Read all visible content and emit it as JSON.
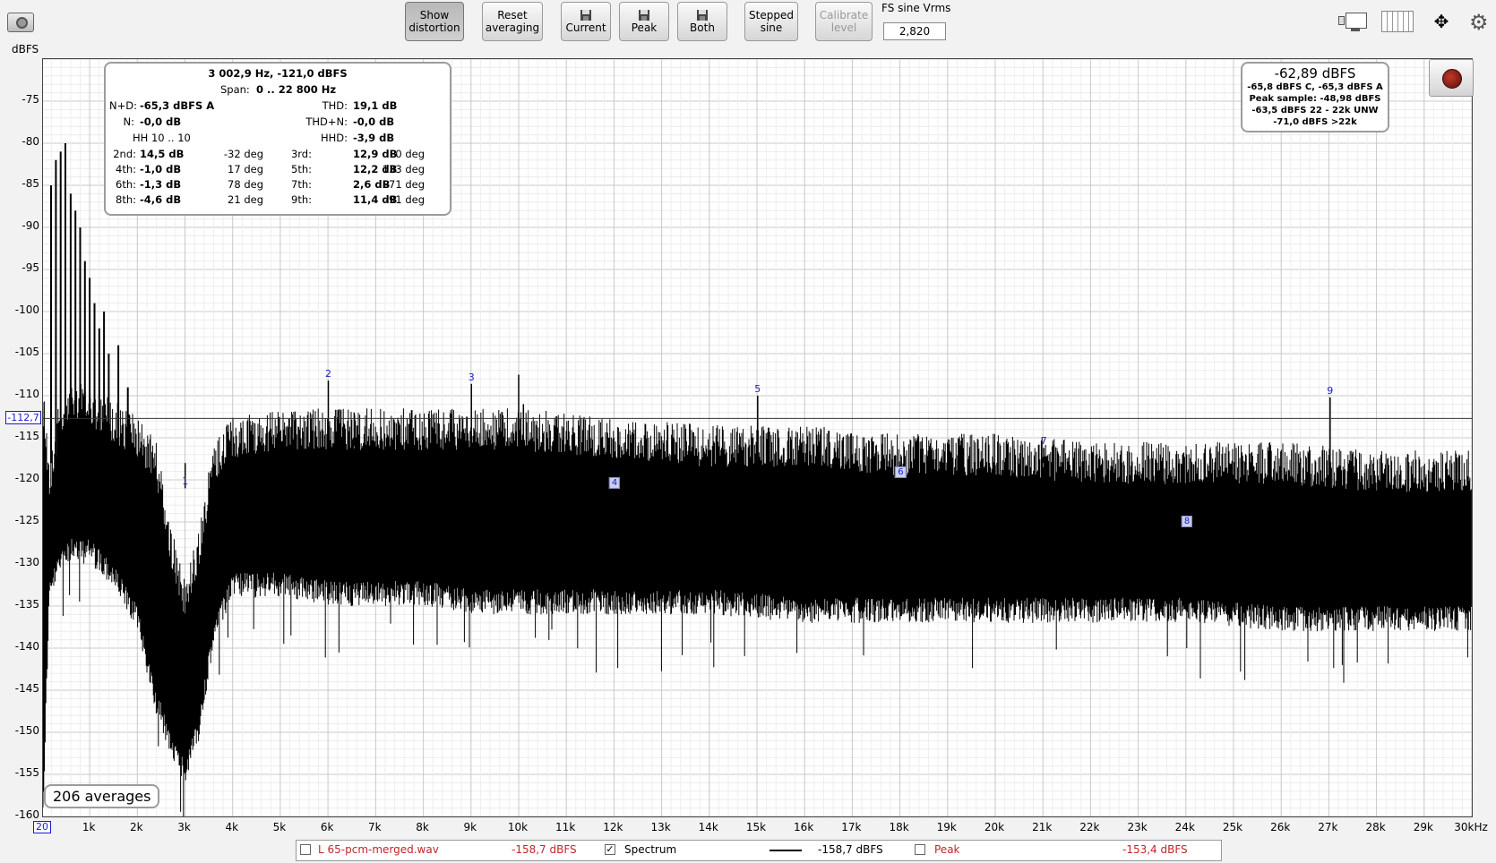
{
  "toolbar": {
    "show_distortion": [
      "Show",
      "distortion"
    ],
    "reset_averaging": [
      "Reset",
      "averaging"
    ],
    "current": "Current",
    "peak": "Peak",
    "both": "Both",
    "stepped_sine": [
      "Stepped",
      "sine"
    ],
    "calibrate_level": [
      "Calibrate",
      "level"
    ],
    "fs_label": "FS sine Vrms",
    "fs_value": "2,820"
  },
  "info": {
    "title": "3 002,9 Hz, -121,0 dBFS",
    "span_label": "Span:",
    "span_value": "0 .. 22 800 Hz",
    "nd_label": "N+D:",
    "nd_value": "-65,3 dBFS A",
    "thd_label": "THD:",
    "thd_value": "19,1 dB",
    "n_label": "N:",
    "n_value": "-0,0 dB",
    "thdn_label": "THD+N:",
    "thdn_value": "-0,0 dB",
    "hh_label": "HH 10 .. 10",
    "hhd_label": "HHD:",
    "hhd_value": "-3,9 dB",
    "harmonics": [
      {
        "label": "2nd:",
        "value": "14,5 dB",
        "phase": "-32 deg"
      },
      {
        "label": "3rd:",
        "value": "12,9 dB",
        "phase": "0 deg"
      },
      {
        "label": "4th:",
        "value": "-1,0 dB",
        "phase": "17 deg"
      },
      {
        "label": "5th:",
        "value": "12,2 dB",
        "phase": "133 deg"
      },
      {
        "label": "6th:",
        "value": "-1,3 dB",
        "phase": "78 deg"
      },
      {
        "label": "7th:",
        "value": "2,6 dB",
        "phase": "-71 deg"
      },
      {
        "label": "8th:",
        "value": "-4,6 dB",
        "phase": "21 deg"
      },
      {
        "label": "9th:",
        "value": "11,4 dB",
        "phase": "-91 deg"
      }
    ]
  },
  "level_panel": {
    "main": "-62,89 dBFS",
    "line1": "-65,8 dBFS C, -65,3 dBFS A",
    "line2": "Peak sample: -48,98 dBFS",
    "line3": "-63,5 dBFS 22 - 22k UNW",
    "line4": "-71,0 dBFS >22k"
  },
  "averages": "206 averages",
  "cursor_level": "-112,7",
  "legend": {
    "file": "L 65-pcm-merged.wav",
    "file_value": "-158,7 dBFS",
    "spectrum": "Spectrum",
    "spectrum_checked": true,
    "spectrum_value": "-158,7 dBFS",
    "peak": "Peak",
    "peak_checked": false,
    "peak_value": "-153,4 dBFS"
  },
  "colors": {
    "harmonic_marker": "#1b1bd0",
    "legend_red": "#c0262c",
    "record": "#8b1b12"
  },
  "chart_data": {
    "type": "line",
    "ylabel": "dBFS",
    "xlabel": "",
    "ylim": [
      -160,
      -70
    ],
    "xlim": [
      20,
      30000
    ],
    "grid": true,
    "y_ticks": [
      -75,
      -80,
      -85,
      -90,
      -95,
      -100,
      -105,
      -110,
      -115,
      -120,
      -125,
      -130,
      -135,
      -140,
      -145,
      -150,
      -155,
      -160
    ],
    "x_ticks": [
      {
        "hz": 20,
        "label": "20"
      },
      {
        "hz": 1000,
        "label": "1k"
      },
      {
        "hz": 2000,
        "label": "2k"
      },
      {
        "hz": 3000,
        "label": "3k"
      },
      {
        "hz": 4000,
        "label": "4k"
      },
      {
        "hz": 5000,
        "label": "5k"
      },
      {
        "hz": 6000,
        "label": "6k"
      },
      {
        "hz": 7000,
        "label": "7k"
      },
      {
        "hz": 8000,
        "label": "8k"
      },
      {
        "hz": 9000,
        "label": "9k"
      },
      {
        "hz": 10000,
        "label": "10k"
      },
      {
        "hz": 11000,
        "label": "11k"
      },
      {
        "hz": 12000,
        "label": "12k"
      },
      {
        "hz": 13000,
        "label": "13k"
      },
      {
        "hz": 14000,
        "label": "14k"
      },
      {
        "hz": 15000,
        "label": "15k"
      },
      {
        "hz": 16000,
        "label": "16k"
      },
      {
        "hz": 17000,
        "label": "17k"
      },
      {
        "hz": 18000,
        "label": "18k"
      },
      {
        "hz": 19000,
        "label": "19k"
      },
      {
        "hz": 20000,
        "label": "20k"
      },
      {
        "hz": 21000,
        "label": "21k"
      },
      {
        "hz": 22000,
        "label": "22k"
      },
      {
        "hz": 23000,
        "label": "23k"
      },
      {
        "hz": 24000,
        "label": "24k"
      },
      {
        "hz": 25000,
        "label": "25k"
      },
      {
        "hz": 26000,
        "label": "26k"
      },
      {
        "hz": 27000,
        "label": "27k"
      },
      {
        "hz": 28000,
        "label": "28k"
      },
      {
        "hz": 29000,
        "label": "29k"
      },
      {
        "hz": 30000,
        "label": "30kHz"
      }
    ],
    "cursor_dbfs": -112.7,
    "envelope": {
      "x": [
        20,
        150,
        400,
        600,
        1000,
        1500,
        2000,
        2400,
        2700,
        3000,
        3300,
        3600,
        4000,
        5000,
        6000,
        7000,
        8000,
        9000,
        10000,
        12000,
        14000,
        16000,
        18000,
        20000,
        22000,
        24000,
        26000,
        28000,
        30000
      ],
      "top": [
        -110,
        -120,
        -112,
        -110,
        -111,
        -113,
        -115,
        -118,
        -128,
        -134,
        -128,
        -118,
        -115,
        -114,
        -114,
        -114,
        -114,
        -114,
        -114,
        -115,
        -116,
        -116,
        -117,
        -117,
        -118,
        -118,
        -118,
        -119,
        -119
      ],
      "bottom": [
        -158,
        -132,
        -128,
        -127,
        -127,
        -130,
        -135,
        -145,
        -150,
        -153,
        -148,
        -137,
        -131,
        -131,
        -132,
        -132,
        -132,
        -133,
        -133,
        -133,
        -133,
        -134,
        -134,
        -134,
        -134,
        -134,
        -135,
        -135,
        -135
      ]
    },
    "low_freq_spikes": [
      {
        "hz": 190,
        "dbfs": -85
      },
      {
        "hz": 290,
        "dbfs": -82
      },
      {
        "hz": 390,
        "dbfs": -81
      },
      {
        "hz": 490,
        "dbfs": -80
      },
      {
        "hz": 600,
        "dbfs": -86
      },
      {
        "hz": 700,
        "dbfs": -88
      },
      {
        "hz": 800,
        "dbfs": -90
      },
      {
        "hz": 900,
        "dbfs": -94
      },
      {
        "hz": 1000,
        "dbfs": -96
      },
      {
        "hz": 1100,
        "dbfs": -99
      },
      {
        "hz": 1200,
        "dbfs": -102
      },
      {
        "hz": 1300,
        "dbfs": -100
      },
      {
        "hz": 1400,
        "dbfs": -105
      },
      {
        "hz": 1600,
        "dbfs": -104
      },
      {
        "hz": 1800,
        "dbfs": -109
      }
    ],
    "harmonics": [
      {
        "label": "1",
        "hz": 3002.9,
        "dbfs": -121.0,
        "boxed": false
      },
      {
        "label": "2",
        "hz": 6006,
        "dbfs": -108.2,
        "boxed": false
      },
      {
        "label": "3",
        "hz": 9009,
        "dbfs": -108.6,
        "boxed": false
      },
      {
        "label": "4",
        "hz": 12012,
        "dbfs": -120.3,
        "boxed": true
      },
      {
        "label": "5",
        "hz": 15015,
        "dbfs": -110.0,
        "boxed": false
      },
      {
        "label": "6",
        "hz": 18017,
        "dbfs": -119.0,
        "boxed": true
      },
      {
        "label": "7",
        "hz": 21020,
        "dbfs": -116.2,
        "boxed": false
      },
      {
        "label": "8",
        "hz": 24023,
        "dbfs": -124.9,
        "boxed": true
      },
      {
        "label": "9",
        "hz": 27026,
        "dbfs": -110.2,
        "boxed": false
      }
    ],
    "other_spurs": [
      {
        "hz": 6550,
        "dbfs": -112
      },
      {
        "hz": 10000,
        "dbfs": -107.5
      },
      {
        "hz": 10100,
        "dbfs": -111
      }
    ]
  }
}
